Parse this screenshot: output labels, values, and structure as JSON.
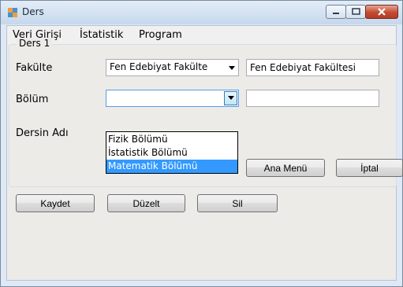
{
  "window": {
    "title": "Ders"
  },
  "menu": {
    "items": [
      "Veri Girişi",
      "İstatistik",
      "Program"
    ]
  },
  "group": {
    "title": "Ders 1"
  },
  "fields": {
    "fakulte_label": "Fakülte",
    "fakulte_combo_value": "Fen Edebiyat Fakülte",
    "fakulte_text_value": "Fen Edebiyat Fakültesi",
    "bolum_label": "Bölüm",
    "bolum_combo_value": "",
    "bolum_text_value": "",
    "dersin_adi_label": "Dersin Adı"
  },
  "dropdown": {
    "options": [
      "Fizik Bölümü",
      "İstatistik Bölümü",
      "Matematik Bölümü"
    ],
    "selected_index": 2
  },
  "buttons": {
    "ana_menu": "Ana Menü",
    "iptal": "İptal",
    "kaydet": "Kaydet",
    "duzelt": "Düzelt",
    "sil": "Sil"
  },
  "colors": {
    "selection": "#3399ff",
    "titlebar": "#c6d7eb",
    "close": "#c44a32"
  }
}
